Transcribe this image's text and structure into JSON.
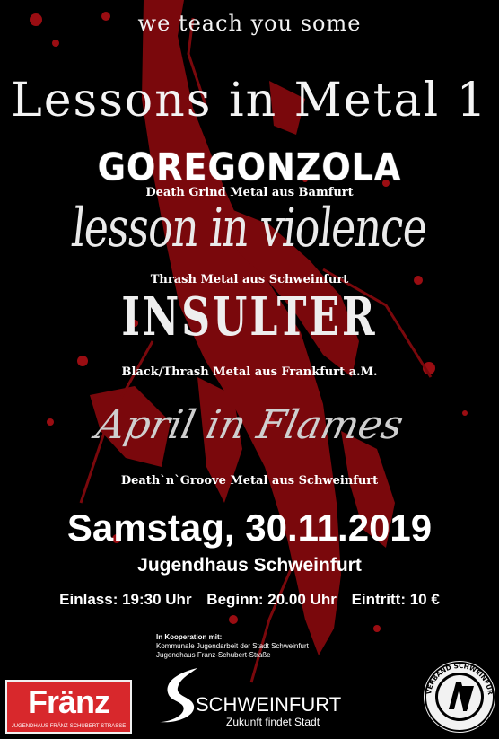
{
  "tagline": "we teach you some",
  "title": "Lessons in Metal 1",
  "bands": [
    {
      "name": "GOREGONZOLA",
      "genre": "Death Grind Metal aus Bamfurt"
    },
    {
      "name": "lesson in violence",
      "genre": "Thrash Metal aus Schweinfurt"
    },
    {
      "name": "INSULTER",
      "genre": "Black/Thrash Metal aus Frankfurt a.M."
    },
    {
      "name": "April in Flames",
      "genre": "Death`n`Groove Metal aus Schweinfurt"
    }
  ],
  "event": {
    "date": "Samstag, 30.11.2019",
    "venue": "Jugendhaus Schweinfurt",
    "einlass": "Einlass: 19:30 Uhr",
    "beginn": "Beginn: 20.00 Uhr",
    "eintritt": "Eintritt: 10 €"
  },
  "cooperation": {
    "heading": "In Kooperation mit:",
    "line1": "Kommunale Jugendarbeit der Stadt Schweinfurt",
    "line2": "Jugendhaus Franz-Schubert-Straße"
  },
  "logos": {
    "franz": {
      "word": "Fränz",
      "sub": "JUGENDHAUS FRÄNZ-SCHUBERT-STRASSE"
    },
    "schweinfurt": {
      "name": "SCHWEINFURT",
      "tagline": "Zukunft findet Stadt"
    },
    "rockverband": {
      "text": "ROCKVERBAND SCHWEINFURT e.V."
    }
  },
  "colors": {
    "background": "#000000",
    "blood": "#8a0a0e",
    "franz_red": "#d8282c"
  }
}
